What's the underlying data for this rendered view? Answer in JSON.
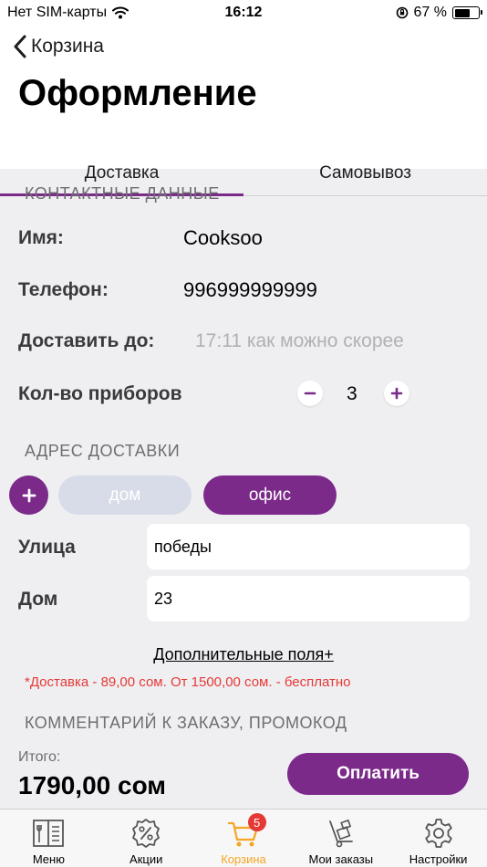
{
  "status_bar": {
    "carrier": "Нет SIM-карты",
    "time": "16:12",
    "battery": "67 %",
    "battery_level": 0.67
  },
  "header": {
    "back_label": "Корзина",
    "title": "Оформление"
  },
  "tabs": [
    {
      "label": "Доставка",
      "active": true
    },
    {
      "label": "Самовывоз",
      "active": false
    }
  ],
  "contacts": {
    "section_title": "КОНТАКТНЫЕ ДАННЫЕ",
    "name_label": "Имя:",
    "name_value": "Cooksoo",
    "phone_label": "Телефон:",
    "phone_value": "996999999999",
    "deliver_label": "Доставить до:",
    "deliver_placeholder": "17:11 как можно скорее",
    "cutlery_label": "Кол-во приборов",
    "cutlery_count": "3"
  },
  "address": {
    "section_title": "АДРЕС ДОСТАВКИ",
    "chips": [
      {
        "label": "дом",
        "selected": false
      },
      {
        "label": "офис",
        "selected": true
      }
    ],
    "street_label": "Улица",
    "street_value": "победы",
    "house_label": "Дом",
    "house_value": "23",
    "extra_fields": "Дополнительные поля+",
    "delivery_note": "*Доставка - 89,00 сом. От 1500,00 сом. - бесплатно"
  },
  "comment": {
    "section_title": "КОММЕНТАРИЙ К ЗАКАЗУ, ПРОМОКОД"
  },
  "checkout": {
    "total_label": "Итого:",
    "total_value": "1790,00 сом",
    "pay_label": "Оплатить"
  },
  "tab_bar": {
    "items": [
      {
        "label": "Меню",
        "icon": "menu-book-icon"
      },
      {
        "label": "Акции",
        "icon": "discount-icon"
      },
      {
        "label": "Корзина",
        "icon": "cart-icon",
        "badge": "5",
        "active": true
      },
      {
        "label": "Мои заказы",
        "icon": "orders-icon"
      },
      {
        "label": "Настройки",
        "icon": "settings-icon"
      }
    ]
  },
  "colors": {
    "accent": "#7b2a8a",
    "active_tab": "#f5a623",
    "note": "#e53935",
    "chip_inactive": "#d8dce8"
  }
}
